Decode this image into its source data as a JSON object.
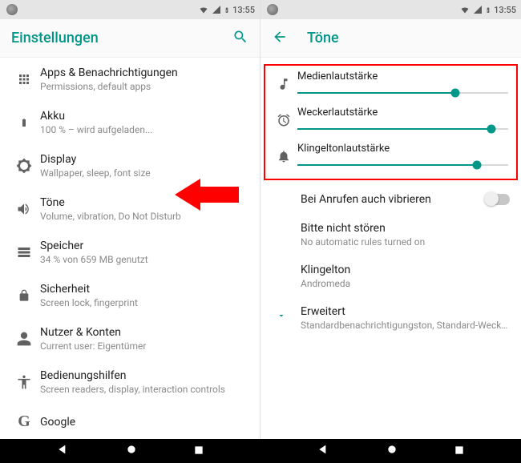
{
  "status": {
    "time": "13:55"
  },
  "left": {
    "title": "Einstellungen",
    "items": [
      {
        "title": "Apps & Benachrichtigungen",
        "sub": "Permissions, default apps"
      },
      {
        "title": "Akku",
        "sub": "100 % – wird aufgeladen..."
      },
      {
        "title": "Display",
        "sub": "Wallpaper, sleep, font size"
      },
      {
        "title": "Töne",
        "sub": "Volume, vibration, Do Not Disturb"
      },
      {
        "title": "Speicher",
        "sub": "34 % von 659 MB genutzt"
      },
      {
        "title": "Sicherheit",
        "sub": "Screen lock, fingerprint"
      },
      {
        "title": "Nutzer & Konten",
        "sub": "Current user: Eigentümer"
      },
      {
        "title": "Bedienungshilfen",
        "sub": "Screen readers, display, interaction controls"
      },
      {
        "title": "Google",
        "sub": ""
      }
    ]
  },
  "right": {
    "title": "Töne",
    "sliders": [
      {
        "label": "Medienlautstärke",
        "pct": 75
      },
      {
        "label": "Weckerlautstärke",
        "pct": 92
      },
      {
        "label": "Klingeltonlautstärke",
        "pct": 85
      }
    ],
    "vibrate": {
      "label": "Bei Anrufen auch vibrieren",
      "on": false
    },
    "dnd": {
      "label": "Bitte nicht stören",
      "sub": "No automatic rules turned on"
    },
    "ringtone": {
      "label": "Klingelton",
      "sub": "Andromeda"
    },
    "advanced": {
      "label": "Erweitert",
      "sub": "Standardbenachrichtigungston, Standard-Weckert.."
    }
  }
}
